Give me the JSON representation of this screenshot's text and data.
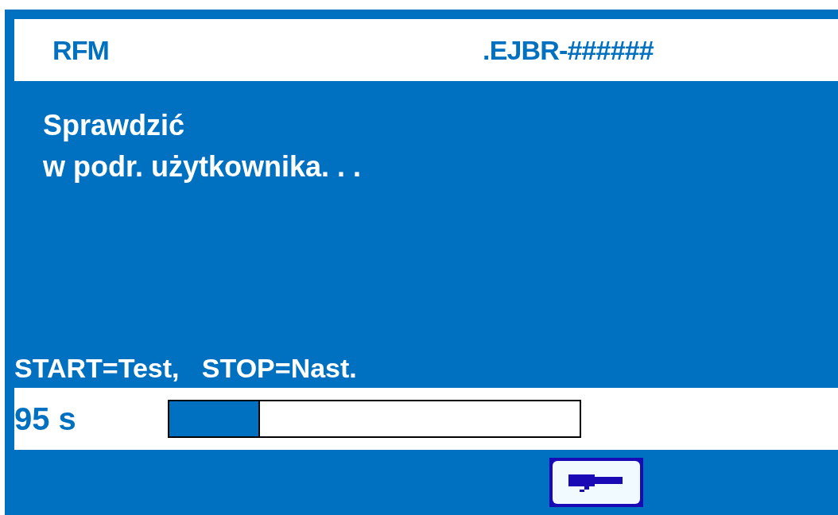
{
  "header": {
    "left": "RFM",
    "right": ".EJBR-######"
  },
  "message": [
    "Sprawdzić",
    "w podr. użytkownika. . ."
  ],
  "hint": "START=Test,   STOP=Nast.",
  "timer": {
    "label": "95 s",
    "level": 0.22
  },
  "button": {
    "kind": "enter"
  }
}
